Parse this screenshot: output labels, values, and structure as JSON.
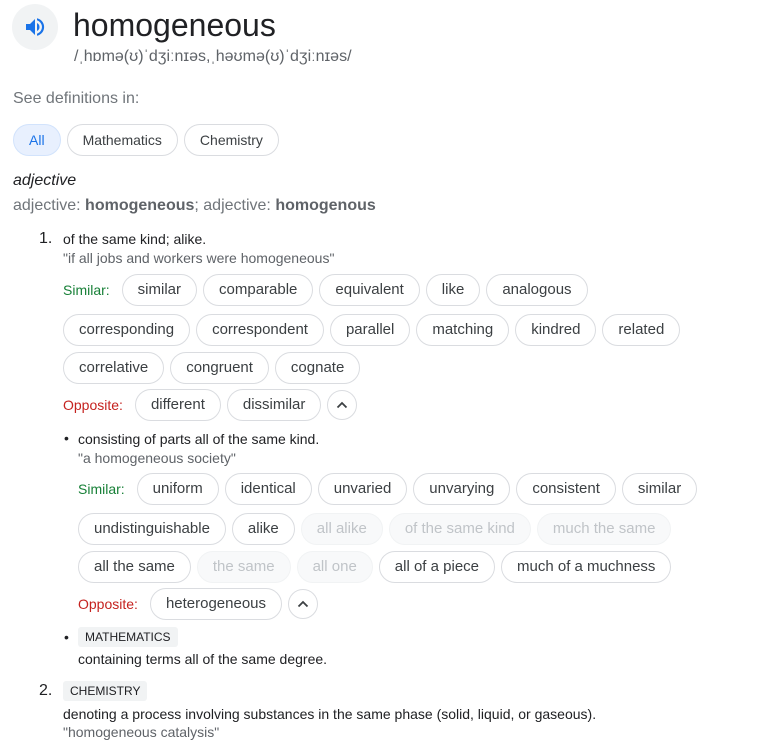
{
  "headword": "homogeneous",
  "pronunciation": "/ˌhɒmə(ʊ)ˈdʒiːnɪəs,ˌhəʊmə(ʊ)ˈdʒiːnɪəs/",
  "icons": {
    "speaker": "speaker-icon",
    "collapse": "chevron-up-icon"
  },
  "see_definitions": {
    "label": "See definitions in:",
    "tabs": [
      "All",
      "Mathematics",
      "Chemistry"
    ],
    "active": "All"
  },
  "part_of_speech": "adjective",
  "forms": {
    "prefix1": "adjective: ",
    "form1": "homogeneous",
    "sep": "; adjective: ",
    "form2": "homogenous"
  },
  "labels": {
    "similar": "Similar:",
    "opposite": "Opposite:"
  },
  "senses": [
    {
      "number": "1.",
      "definition": "of the same kind; alike.",
      "example": "\"if all jobs and workers were homogeneous\"",
      "similar_rows": [
        [
          "similar",
          "comparable",
          "equivalent",
          "like",
          "analogous"
        ],
        [
          "corresponding",
          "correspondent",
          "parallel",
          "matching",
          "kindred",
          "related"
        ],
        [
          "correlative",
          "congruent",
          "cognate"
        ]
      ],
      "opposite": [
        "different",
        "dissimilar"
      ]
    },
    {
      "bullet": "•",
      "definition": "consisting of parts all of the same kind.",
      "example": "\"a homogeneous society\"",
      "similar_rows": [
        [
          "uniform",
          "identical",
          "unvaried",
          "unvarying",
          "consistent",
          "similar"
        ],
        [
          "undistinguishable",
          "alike",
          "all alike",
          "of the same kind",
          "much the same"
        ],
        [
          "all the same",
          "the same",
          "all one",
          "all of a piece",
          "much of a muchness"
        ]
      ],
      "dimmed": [
        "all alike",
        "of the same kind",
        "much the same",
        "the same",
        "all one"
      ],
      "opposite": [
        "heterogeneous"
      ]
    },
    {
      "bullet": "•",
      "tag": "MATHEMATICS",
      "definition": "containing terms all of the same degree."
    },
    {
      "number": "2.",
      "tag": "CHEMISTRY",
      "definition": "denoting a process involving substances in the same phase (solid, liquid, or gaseous).",
      "example": "\"homogeneous catalysis\""
    }
  ],
  "colors": {
    "similar_label": "#188038",
    "opposite_label": "#c5221f",
    "active_tab": "#1a73e8"
  }
}
